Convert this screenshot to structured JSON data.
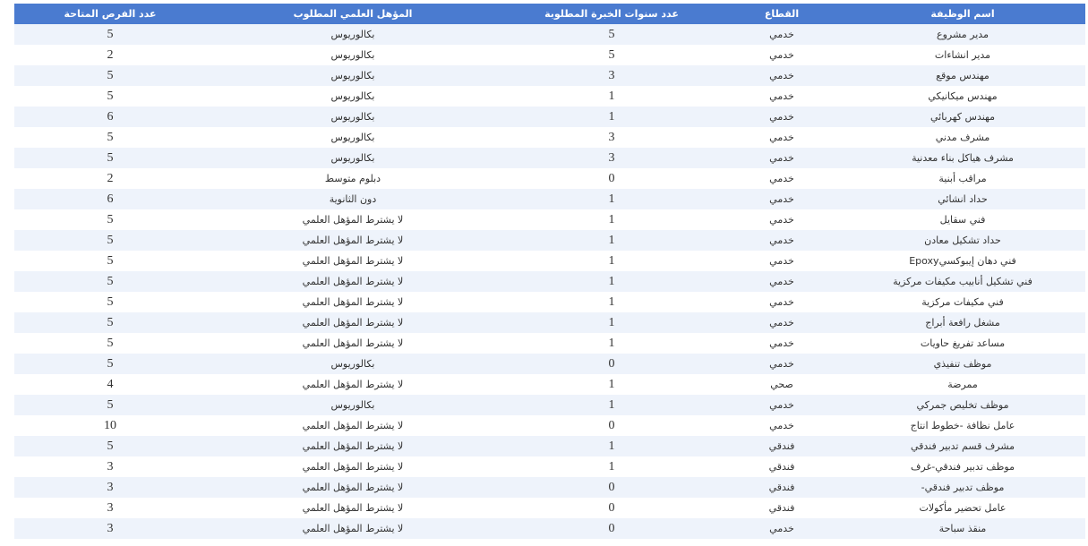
{
  "table": {
    "headers": {
      "job_title": "اسم الوظيفة",
      "sector": "القطاع",
      "experience_years": "عدد سنوات الخبرة المطلوبة",
      "qualification": "المؤهل العلمي المطلوب",
      "openings": "عدد الفرص المتاحة"
    },
    "rows": [
      {
        "job_title": "مدير مشروع",
        "sector": "خدمي",
        "experience_years": "5",
        "qualification": "بكالوريوس",
        "openings": "5"
      },
      {
        "job_title": "مدير انشاءات",
        "sector": "خدمي",
        "experience_years": "5",
        "qualification": "بكالوريوس",
        "openings": "2"
      },
      {
        "job_title": "مهندس موقع",
        "sector": "خدمي",
        "experience_years": "3",
        "qualification": "بكالوريوس",
        "openings": "5"
      },
      {
        "job_title": "مهندس ميكانيكي",
        "sector": "خدمي",
        "experience_years": "1",
        "qualification": "بكالوريوس",
        "openings": "5"
      },
      {
        "job_title": "مهندس كهربائي",
        "sector": "خدمي",
        "experience_years": "1",
        "qualification": "بكالوريوس",
        "openings": "6"
      },
      {
        "job_title": "مشرف مدني",
        "sector": "خدمي",
        "experience_years": "3",
        "qualification": "بكالوريوس",
        "openings": "5"
      },
      {
        "job_title": "مشرف هياكل بناء معدنية",
        "sector": "خدمي",
        "experience_years": "3",
        "qualification": "بكالوريوس",
        "openings": "5"
      },
      {
        "job_title": "مراقب أبنية",
        "sector": "خدمي",
        "experience_years": "0",
        "qualification": "دبلوم متوسط",
        "openings": "2"
      },
      {
        "job_title": "حداد انشائي",
        "sector": "خدمي",
        "experience_years": "1",
        "qualification": "دون الثانوية",
        "openings": "6"
      },
      {
        "job_title": "فني سقايل",
        "sector": "خدمي",
        "experience_years": "1",
        "qualification": "لا يشترط المؤهل العلمي",
        "openings": "5"
      },
      {
        "job_title": "حداد تشكيل معادن",
        "sector": "خدمي",
        "experience_years": "1",
        "qualification": "لا يشترط المؤهل العلمي",
        "openings": "5"
      },
      {
        "job_title": "فني دهان إيبوكسيEpoxy",
        "sector": "خدمي",
        "experience_years": "1",
        "qualification": "لا يشترط المؤهل العلمي",
        "openings": "5"
      },
      {
        "job_title": "فني تشكيل أنابيب مكيفات مركزية",
        "sector": "خدمي",
        "experience_years": "1",
        "qualification": "لا يشترط المؤهل العلمي",
        "openings": "5"
      },
      {
        "job_title": "فني مكيفات مركزية",
        "sector": "خدمي",
        "experience_years": "1",
        "qualification": "لا يشترط المؤهل العلمي",
        "openings": "5"
      },
      {
        "job_title": "مشغل رافعة أبراج",
        "sector": "خدمي",
        "experience_years": "1",
        "qualification": "لا يشترط المؤهل العلمي",
        "openings": "5"
      },
      {
        "job_title": "مساعد تفريغ حاويات",
        "sector": "خدمي",
        "experience_years": "1",
        "qualification": "لا يشترط المؤهل العلمي",
        "openings": "5"
      },
      {
        "job_title": "موظف تنفيذي",
        "sector": "خدمي",
        "experience_years": "0",
        "qualification": "بكالوريوس",
        "openings": "5"
      },
      {
        "job_title": "ممرضة",
        "sector": "صحي",
        "experience_years": "1",
        "qualification": "لا يشترط المؤهل العلمي",
        "openings": "4"
      },
      {
        "job_title": "موظف تخليص جمركي",
        "sector": "خدمي",
        "experience_years": "1",
        "qualification": "بكالوريوس",
        "openings": "5"
      },
      {
        "job_title": "عامل نظافة -خطوط انتاج",
        "sector": "خدمي",
        "experience_years": "0",
        "qualification": "لا يشترط المؤهل العلمي",
        "openings": "10"
      },
      {
        "job_title": "مشرف قسم تدبير فندقي",
        "sector": "فندقي",
        "experience_years": "1",
        "qualification": "لا يشترط المؤهل العلمي",
        "openings": "5"
      },
      {
        "job_title": "موظف تدبير فندقي-غرف",
        "sector": "فندقي",
        "experience_years": "1",
        "qualification": "لا يشترط المؤهل العلمي",
        "openings": "3"
      },
      {
        "job_title": "موظف تدبير فندقي-",
        "sector": "فندقي",
        "experience_years": "0",
        "qualification": "لا يشترط المؤهل العلمي",
        "openings": "3"
      },
      {
        "job_title": "عامل تحضير مأكولات",
        "sector": "فندقي",
        "experience_years": "0",
        "qualification": "لا يشترط المؤهل العلمي",
        "openings": "3"
      },
      {
        "job_title": "منقذ سباحة",
        "sector": "خدمي",
        "experience_years": "0",
        "qualification": "لا يشترط المؤهل العلمي",
        "openings": "3"
      }
    ]
  },
  "colors": {
    "header_bg": "#4a7bd0",
    "header_text": "#ffffff",
    "stripe_row": "#eef3fb",
    "plain_row": "#ffffff",
    "body_text": "#333333"
  }
}
